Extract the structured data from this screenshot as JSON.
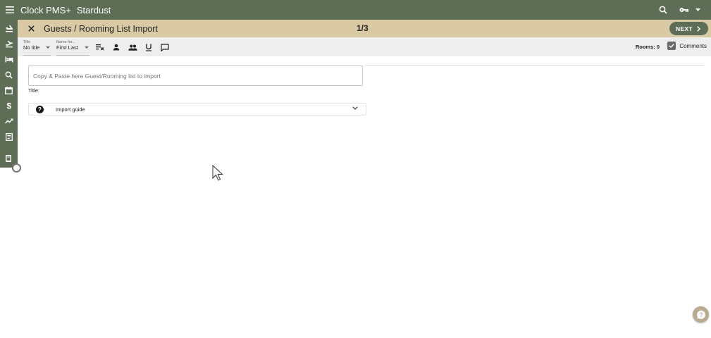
{
  "app": {
    "name": "Clock PMS+",
    "property": "Stardust"
  },
  "header": {
    "title": "Guests / Rooming List Import",
    "step": "1/3",
    "next_label": "NEXT"
  },
  "toolbar": {
    "title_select": {
      "label": "Title",
      "value": "No title"
    },
    "name_select": {
      "label": "Name for...",
      "value": "First Last"
    },
    "rooms_label": "Rooms: 0",
    "comments_label": "Comments",
    "comments_checked": true
  },
  "main": {
    "paste_placeholder": "Copy & Paste here Guest/Rooming list to import",
    "title_label": "Title:",
    "import_guide_label": "Import guide"
  },
  "colors": {
    "brand": "#5d6d56",
    "header_bg": "#d9caa5",
    "toolbar_bg": "#eeeeee"
  },
  "icons": [
    "menu-icon",
    "search-icon",
    "key-icon",
    "caret-down-icon",
    "arrival-icon",
    "departure-icon",
    "bed-icon",
    "search-icon",
    "calendar-icon",
    "dollar-icon",
    "trending-icon",
    "receipt-icon",
    "book-icon",
    "close-icon",
    "chevron-right-icon",
    "clear-format-icon",
    "person-icon",
    "group-icon",
    "underline-icon",
    "comment-icon",
    "help-icon",
    "chevron-down-icon"
  ]
}
